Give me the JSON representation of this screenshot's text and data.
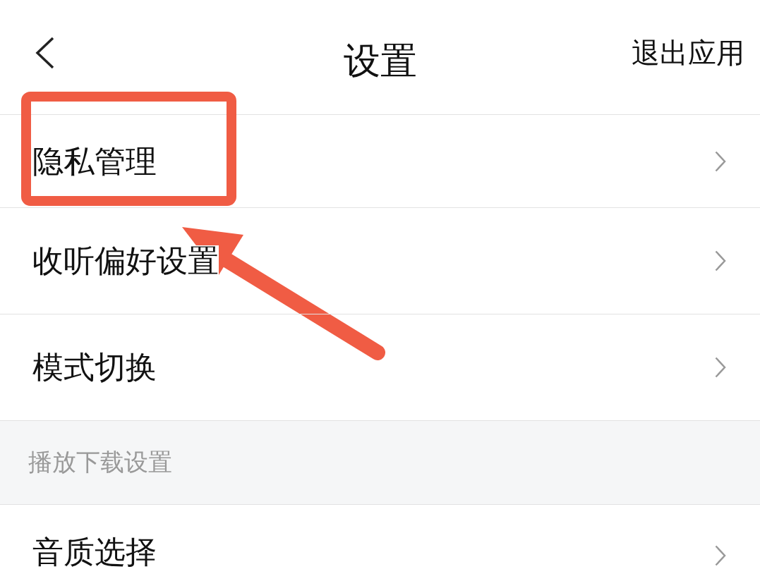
{
  "header": {
    "title": "设置",
    "action": "退出应用"
  },
  "rows": [
    {
      "kind": "item",
      "label": "隐私管理"
    },
    {
      "kind": "item",
      "label": "收听偏好设置"
    },
    {
      "kind": "item",
      "label": "模式切换"
    },
    {
      "kind": "section",
      "label": "播放下载设置"
    },
    {
      "kind": "item",
      "label": "音质选择"
    }
  ]
}
